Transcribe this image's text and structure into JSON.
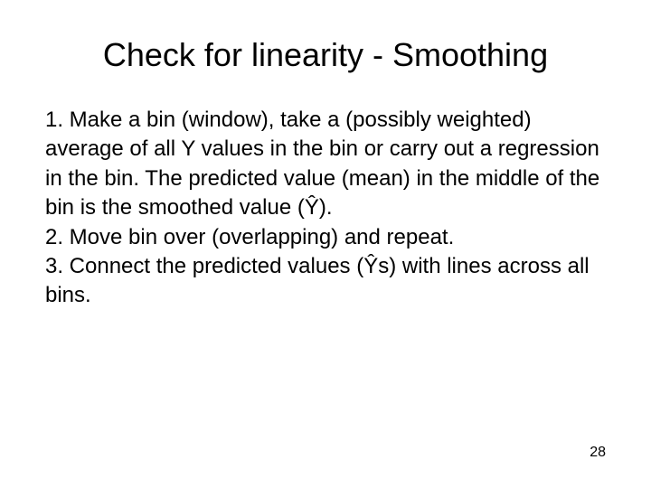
{
  "title": "Check for linearity - Smoothing",
  "steps": {
    "s1": "1. Make a bin (window), take a (possibly weighted) average of all Y values in the bin or carry out a regression in the bin. The predicted value (mean) in the middle of the bin is the smoothed value (Ŷ).",
    "s2": "2. Move bin over (overlapping) and repeat.",
    "s3": "3. Connect the predicted values (Ŷs) with lines across all bins."
  },
  "pageNumber": "28"
}
